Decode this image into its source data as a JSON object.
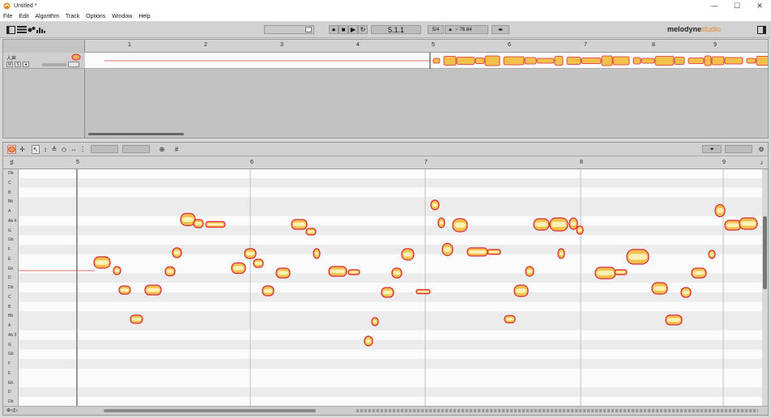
{
  "window": {
    "title": "Untitled *",
    "min": "—",
    "max": "☐",
    "close": "✕"
  },
  "menu": [
    "File",
    "Edit",
    "Algorithm",
    "Track",
    "Options",
    "Window",
    "Help"
  ],
  "transport": {
    "position": "5.1.1",
    "time_signature": "5/4",
    "tempo_prefix": "~",
    "tempo": "76.64"
  },
  "brand": {
    "name": "melodyne",
    "edition": "studio"
  },
  "track": {
    "name": "人声",
    "mute": "M",
    "solo": "S"
  },
  "arrange_ruler": [
    "1",
    "2",
    "3",
    "4",
    "5",
    "6",
    "7",
    "8",
    "9"
  ],
  "editor_ruler": [
    "5",
    "6",
    "7",
    "8",
    "9"
  ],
  "pitch_keys": [
    "Db",
    "C",
    "B",
    "Bb",
    "A",
    "Ab 4",
    "G",
    "Gb",
    "F",
    "E",
    "Eb",
    "D",
    "Db",
    "C",
    "B",
    "Bb",
    "A",
    "Ab 3",
    "G",
    "Gb",
    "F",
    "E",
    "Eb",
    "D",
    "Db"
  ],
  "colors": {
    "blob_outer": "#d8283c",
    "blob_inner": "#f3c04c",
    "blob_core": "#fff2b8",
    "playhead": "#d84848"
  },
  "icons": [
    "melodyne-app-icon",
    "minimize-icon",
    "maximize-icon",
    "close-icon",
    "editor-layout-icon",
    "track-list-icon",
    "tool-icon",
    "level-icon",
    "record-icon",
    "stop-icon",
    "play-icon",
    "loop-icon",
    "tempo-icon",
    "main-tool-icon",
    "pitch-tool-icon",
    "time-tool-icon",
    "amplitude-tool-icon",
    "formant-tool-icon",
    "separation-tool-icon",
    "zoom-icon",
    "scroll-icon",
    "settings-icon"
  ]
}
